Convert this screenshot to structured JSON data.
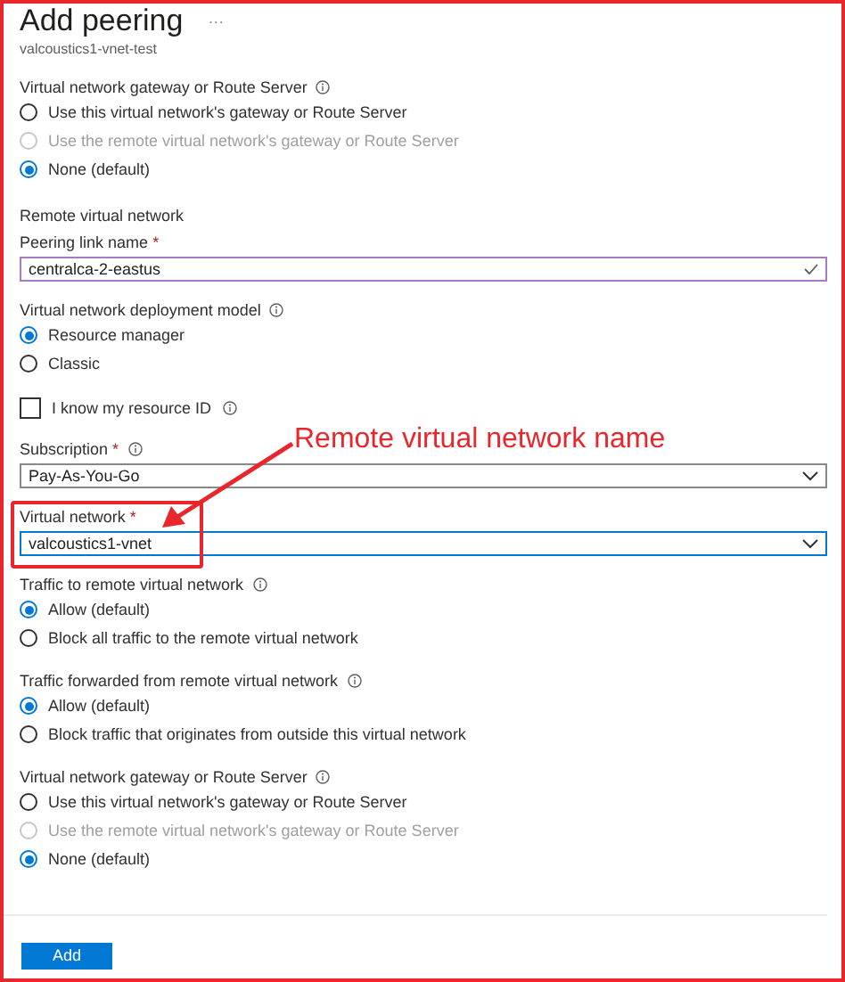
{
  "title": "Add peering",
  "more_glyph": "···",
  "subtitle": "valcoustics1-vnet-test",
  "sections": [
    {
      "kind": "radio_group",
      "label": "Virtual network gateway or Route Server",
      "info": true,
      "options": [
        {
          "label": "Use this virtual network's gateway or Route Server",
          "selected": false,
          "disabled": false
        },
        {
          "label": "Use the remote virtual network's gateway or Route Server",
          "selected": false,
          "disabled": true
        },
        {
          "label": "None (default)",
          "selected": true,
          "disabled": false
        }
      ]
    },
    {
      "kind": "heading",
      "label": "Remote virtual network"
    },
    {
      "kind": "text_field",
      "label": "Peering link name",
      "required": "*",
      "value": "centralca-2-eastus",
      "valid": true
    },
    {
      "kind": "radio_group",
      "label": "Virtual network deployment model",
      "info": true,
      "options": [
        {
          "label": "Resource manager",
          "selected": true,
          "disabled": false
        },
        {
          "label": "Classic",
          "selected": false,
          "disabled": false
        }
      ]
    },
    {
      "kind": "checkbox",
      "label": "I know my resource ID",
      "info": true,
      "checked": false
    },
    {
      "kind": "select",
      "label": "Subscription",
      "required": "*",
      "info": true,
      "value": "Pay-As-You-Go",
      "focused": false
    },
    {
      "kind": "select",
      "label": "Virtual network",
      "required": "*",
      "value": "valcoustics1-vnet",
      "focused": true
    },
    {
      "kind": "radio_group",
      "label": "Traffic to remote virtual network",
      "info": true,
      "options": [
        {
          "label": "Allow (default)",
          "selected": true,
          "disabled": false
        },
        {
          "label": "Block all traffic to the remote virtual network",
          "selected": false,
          "disabled": false
        }
      ]
    },
    {
      "kind": "radio_group",
      "label": "Traffic forwarded from remote virtual network",
      "info": true,
      "options": [
        {
          "label": "Allow (default)",
          "selected": true,
          "disabled": false
        },
        {
          "label": "Block traffic that originates from outside this virtual network",
          "selected": false,
          "disabled": false
        }
      ]
    },
    {
      "kind": "radio_group",
      "label": "Virtual network gateway or Route Server",
      "info": true,
      "options": [
        {
          "label": "Use this virtual network's gateway or Route Server",
          "selected": false,
          "disabled": false
        },
        {
          "label": "Use the remote virtual network's gateway or Route Server",
          "selected": false,
          "disabled": true
        },
        {
          "label": "None (default)",
          "selected": true,
          "disabled": false
        }
      ]
    }
  ],
  "button": "Add",
  "annotation": {
    "text": "Remote virtual network name"
  }
}
